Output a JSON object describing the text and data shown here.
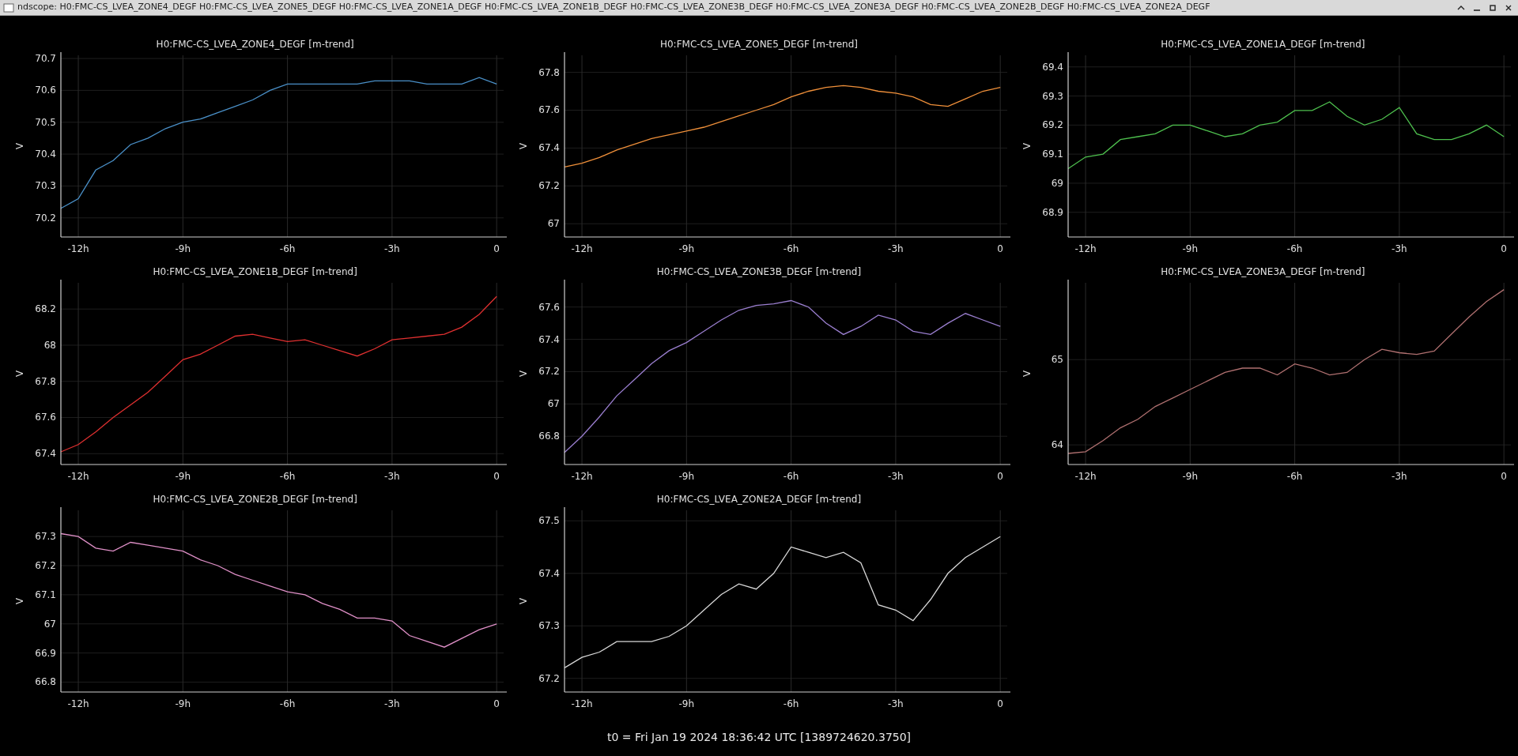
{
  "window": {
    "title": "ndscope: H0:FMC-CS_LVEA_ZONE4_DEGF H0:FMC-CS_LVEA_ZONE5_DEGF H0:FMC-CS_LVEA_ZONE1A_DEGF H0:FMC-CS_LVEA_ZONE1B_DEGF H0:FMC-CS_LVEA_ZONE3B_DEGF H0:FMC-CS_LVEA_ZONE3A_DEGF H0:FMC-CS_LVEA_ZONE2B_DEGF H0:FMC-CS_LVEA_ZONE2A_DEGF"
  },
  "plots": [
    {
      "chart_data": {
        "type": "line",
        "grid": true,
        "title": "H0:FMC-CS_LVEA_ZONE4_DEGF [m-trend]",
        "ylabel": "V",
        "xlim": [
          -12.5,
          0.2
        ],
        "ylim": [
          70.14,
          70.71
        ],
        "yticks": [
          70.2,
          70.3,
          70.4,
          70.5,
          70.6,
          70.7
        ],
        "xticks": [
          {
            "value": -12,
            "label": "-12h"
          },
          {
            "value": -9,
            "label": "-9h"
          },
          {
            "value": -6,
            "label": "-6h"
          },
          {
            "value": -3,
            "label": "-3h"
          },
          {
            "value": 0,
            "label": "0"
          }
        ],
        "x": [
          -12.5,
          -12,
          -11.5,
          -11,
          -10.5,
          -10,
          -9.5,
          -9,
          -8.5,
          -8,
          -7.5,
          -7,
          -6.5,
          -6,
          -5.5,
          -5,
          -4.5,
          -4,
          -3.5,
          -3,
          -2.5,
          -2,
          -1.5,
          -1,
          -0.5,
          0
        ],
        "series": [
          {
            "color": "#4a90c8",
            "values": [
              70.23,
              70.26,
              70.35,
              70.38,
              70.43,
              70.45,
              70.48,
              70.5,
              70.51,
              70.53,
              70.55,
              70.57,
              70.6,
              70.62,
              70.62,
              70.62,
              70.62,
              70.62,
              70.63,
              70.63,
              70.63,
              70.62,
              70.62,
              70.62,
              70.64,
              70.62
            ]
          }
        ]
      }
    },
    {
      "chart_data": {
        "type": "line",
        "grid": true,
        "title": "H0:FMC-CS_LVEA_ZONE5_DEGF [m-trend]",
        "ylabel": "V",
        "xlim": [
          -12.5,
          0.2
        ],
        "ylim": [
          66.93,
          67.89
        ],
        "yticks": [
          67,
          67.2,
          67.4,
          67.6,
          67.8
        ],
        "xticks": [
          {
            "value": -12,
            "label": "-12h"
          },
          {
            "value": -9,
            "label": "-9h"
          },
          {
            "value": -6,
            "label": "-6h"
          },
          {
            "value": -3,
            "label": "-3h"
          },
          {
            "value": 0,
            "label": "0"
          }
        ],
        "x": [
          -12.5,
          -12,
          -11.5,
          -11,
          -10.5,
          -10,
          -9.5,
          -9,
          -8.5,
          -8,
          -7.5,
          -7,
          -6.5,
          -6,
          -5.5,
          -5,
          -4.5,
          -4,
          -3.5,
          -3,
          -2.5,
          -2,
          -1.5,
          -1,
          -0.5,
          0
        ],
        "series": [
          {
            "color": "#f0903a",
            "values": [
              67.3,
              67.32,
              67.35,
              67.39,
              67.42,
              67.45,
              67.47,
              67.49,
              67.51,
              67.54,
              67.57,
              67.6,
              67.63,
              67.67,
              67.7,
              67.72,
              67.73,
              67.72,
              67.7,
              67.69,
              67.67,
              67.63,
              67.62,
              67.66,
              67.7,
              67.72
            ]
          }
        ]
      }
    },
    {
      "chart_data": {
        "type": "line",
        "grid": true,
        "title": "H0:FMC-CS_LVEA_ZONE1A_DEGF [m-trend]",
        "ylabel": "V",
        "xlim": [
          -12.5,
          0.2
        ],
        "ylim": [
          68.815,
          69.44
        ],
        "yticks": [
          68.9,
          69,
          69.1,
          69.2,
          69.3,
          69.4
        ],
        "xticks": [
          {
            "value": -12,
            "label": "-12h"
          },
          {
            "value": -9,
            "label": "-9h"
          },
          {
            "value": -6,
            "label": "-6h"
          },
          {
            "value": -3,
            "label": "-3h"
          },
          {
            "value": 0,
            "label": "0"
          }
        ],
        "x": [
          -12.5,
          -12,
          -11.5,
          -11,
          -10.5,
          -10,
          -9.5,
          -9,
          -8.5,
          -8,
          -7.5,
          -7,
          -6.5,
          -6,
          -5.5,
          -5,
          -4.5,
          -4,
          -3.5,
          -3,
          -2.5,
          -2,
          -1.5,
          -1,
          -0.5,
          0
        ],
        "series": [
          {
            "color": "#4ec04e",
            "values": [
              69.05,
              69.09,
              69.1,
              69.15,
              69.16,
              69.17,
              69.2,
              69.2,
              69.18,
              69.16,
              69.17,
              69.2,
              69.21,
              69.25,
              69.25,
              69.28,
              69.23,
              69.2,
              69.22,
              69.26,
              69.17,
              69.15,
              69.15,
              69.17,
              69.2,
              69.16
            ]
          }
        ]
      }
    },
    {
      "chart_data": {
        "type": "line",
        "grid": true,
        "title": "H0:FMC-CS_LVEA_ZONE1B_DEGF [m-trend]",
        "ylabel": "V",
        "xlim": [
          -12.5,
          0.2
        ],
        "ylim": [
          67.34,
          68.345
        ],
        "yticks": [
          67.4,
          67.6,
          67.8,
          68,
          68.2
        ],
        "xticks": [
          {
            "value": -12,
            "label": "-12h"
          },
          {
            "value": -9,
            "label": "-9h"
          },
          {
            "value": -6,
            "label": "-6h"
          },
          {
            "value": -3,
            "label": "-3h"
          },
          {
            "value": 0,
            "label": "0"
          }
        ],
        "x": [
          -12.5,
          -12,
          -11.5,
          -11,
          -10.5,
          -10,
          -9.5,
          -9,
          -8.5,
          -8,
          -7.5,
          -7,
          -6.5,
          -6,
          -5.5,
          -5,
          -4.5,
          -4,
          -3.5,
          -3,
          -2.5,
          -2,
          -1.5,
          -1,
          -0.5,
          0
        ],
        "series": [
          {
            "color": "#e03030",
            "values": [
              67.41,
              67.45,
              67.52,
              67.6,
              67.67,
              67.74,
              67.83,
              67.92,
              67.95,
              68.0,
              68.05,
              68.06,
              68.04,
              68.02,
              68.03,
              68.0,
              67.97,
              67.94,
              67.98,
              68.03,
              68.04,
              68.05,
              68.06,
              68.1,
              68.17,
              68.27
            ]
          }
        ]
      }
    },
    {
      "chart_data": {
        "type": "line",
        "grid": true,
        "title": "H0:FMC-CS_LVEA_ZONE3B_DEGF [m-trend]",
        "ylabel": "V",
        "xlim": [
          -12.5,
          0.2
        ],
        "ylim": [
          66.625,
          67.75
        ],
        "yticks": [
          66.8,
          67,
          67.2,
          67.4,
          67.6
        ],
        "xticks": [
          {
            "value": -12,
            "label": "-12h"
          },
          {
            "value": -9,
            "label": "-9h"
          },
          {
            "value": -6,
            "label": "-6h"
          },
          {
            "value": -3,
            "label": "-3h"
          },
          {
            "value": 0,
            "label": "0"
          }
        ],
        "x": [
          -12.5,
          -12,
          -11.5,
          -11,
          -10.5,
          -10,
          -9.5,
          -9,
          -8.5,
          -8,
          -7.5,
          -7,
          -6.5,
          -6,
          -5.5,
          -5,
          -4.5,
          -4,
          -3.5,
          -3,
          -2.5,
          -2,
          -1.5,
          -1,
          -0.5,
          0
        ],
        "series": [
          {
            "color": "#9b7fd0",
            "values": [
              66.7,
              66.8,
              66.92,
              67.05,
              67.15,
              67.25,
              67.33,
              67.38,
              67.45,
              67.52,
              67.58,
              67.61,
              67.62,
              67.64,
              67.6,
              67.5,
              67.43,
              67.48,
              67.55,
              67.52,
              67.45,
              67.43,
              67.5,
              67.56,
              67.52,
              67.48
            ]
          }
        ]
      }
    },
    {
      "chart_data": {
        "type": "line",
        "grid": true,
        "title": "H0:FMC-CS_LVEA_ZONE3A_DEGF [m-trend]",
        "ylabel": "V",
        "xlim": [
          -12.5,
          0.2
        ],
        "ylim": [
          63.77,
          65.9
        ],
        "yticks": [
          64,
          65
        ],
        "xticks": [
          {
            "value": -12,
            "label": "-12h"
          },
          {
            "value": -9,
            "label": "-9h"
          },
          {
            "value": -6,
            "label": "-6h"
          },
          {
            "value": -3,
            "label": "-3h"
          },
          {
            "value": 0,
            "label": "0"
          }
        ],
        "x": [
          -12.5,
          -12,
          -11.5,
          -11,
          -10.5,
          -10,
          -9.5,
          -9,
          -8.5,
          -8,
          -7.5,
          -7,
          -6.5,
          -6,
          -5.5,
          -5,
          -4.5,
          -4,
          -3.5,
          -3,
          -2.5,
          -2,
          -1.5,
          -1,
          -0.5,
          0
        ],
        "series": [
          {
            "color": "#b07070",
            "values": [
              63.9,
              63.92,
              64.05,
              64.2,
              64.3,
              64.45,
              64.55,
              64.65,
              64.75,
              64.85,
              64.9,
              64.9,
              64.82,
              64.95,
              64.9,
              64.82,
              64.85,
              65.0,
              65.12,
              65.08,
              65.06,
              65.1,
              65.3,
              65.5,
              65.68,
              65.82
            ]
          }
        ]
      }
    },
    {
      "chart_data": {
        "type": "line",
        "grid": true,
        "title": "H0:FMC-CS_LVEA_ZONE2B_DEGF [m-trend]",
        "ylabel": "V",
        "xlim": [
          -12.5,
          0.2
        ],
        "ylim": [
          66.766,
          67.39
        ],
        "yticks": [
          66.8,
          66.9,
          67,
          67.1,
          67.2,
          67.3
        ],
        "xticks": [
          {
            "value": -12,
            "label": "-12h"
          },
          {
            "value": -9,
            "label": "-9h"
          },
          {
            "value": -6,
            "label": "-6h"
          },
          {
            "value": -3,
            "label": "-3h"
          },
          {
            "value": 0,
            "label": "0"
          }
        ],
        "x": [
          -12.5,
          -12,
          -11.5,
          -11,
          -10.5,
          -10,
          -9.5,
          -9,
          -8.5,
          -8,
          -7.5,
          -7,
          -6.5,
          -6,
          -5.5,
          -5,
          -4.5,
          -4,
          -3.5,
          -3,
          -2.5,
          -2,
          -1.5,
          -1,
          -0.5,
          0
        ],
        "series": [
          {
            "color": "#e090c8",
            "values": [
              67.31,
              67.3,
              67.26,
              67.25,
              67.28,
              67.27,
              67.26,
              67.25,
              67.22,
              67.2,
              67.17,
              67.15,
              67.13,
              67.11,
              67.1,
              67.07,
              67.05,
              67.02,
              67.02,
              67.01,
              66.96,
              66.94,
              66.92,
              66.95,
              66.98,
              67.0
            ]
          }
        ]
      }
    },
    {
      "chart_data": {
        "type": "line",
        "grid": true,
        "title": "H0:FMC-CS_LVEA_ZONE2A_DEGF [m-trend]",
        "ylabel": "V",
        "xlim": [
          -12.5,
          0.2
        ],
        "ylim": [
          67.174,
          67.52
        ],
        "yticks": [
          67.2,
          67.3,
          67.4,
          67.5
        ],
        "xticks": [
          {
            "value": -12,
            "label": "-12h"
          },
          {
            "value": -9,
            "label": "-9h"
          },
          {
            "value": -6,
            "label": "-6h"
          },
          {
            "value": -3,
            "label": "-3h"
          },
          {
            "value": 0,
            "label": "0"
          }
        ],
        "x": [
          -12.5,
          -12,
          -11.5,
          -11,
          -10.5,
          -10,
          -9.5,
          -9,
          -8.5,
          -8,
          -7.5,
          -7,
          -6.5,
          -6,
          -5.5,
          -5,
          -4.5,
          -4,
          -3.5,
          -3,
          -2.5,
          -2,
          -1.5,
          -1,
          -0.5,
          0
        ],
        "series": [
          {
            "color": "#d8d8d8",
            "values": [
              67.22,
              67.24,
              67.25,
              67.27,
              67.27,
              67.27,
              67.28,
              67.3,
              67.33,
              67.36,
              67.38,
              67.37,
              67.4,
              67.45,
              67.44,
              67.43,
              67.44,
              67.42,
              67.34,
              67.33,
              67.31,
              67.35,
              67.4,
              67.43,
              67.45,
              67.47
            ]
          }
        ]
      }
    }
  ],
  "status": "t0 = Fri Jan 19 2024 18:36:42 UTC [1389724620.3750]"
}
